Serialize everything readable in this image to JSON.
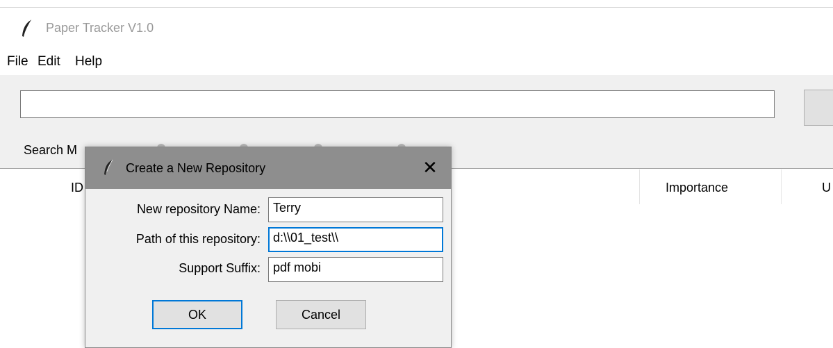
{
  "window": {
    "title": "Paper Tracker V1.0",
    "icon": "feather-icon"
  },
  "menu": {
    "items": [
      "File",
      "Edit",
      "Help"
    ]
  },
  "search": {
    "value": "",
    "mode_label": "Search M"
  },
  "table": {
    "headers": [
      "ID",
      "Importance",
      "U"
    ]
  },
  "dialog": {
    "title": "Create a New Repository",
    "icon": "feather-icon",
    "fields": [
      {
        "label": "New repository Name:",
        "value": "Terry"
      },
      {
        "label": "Path of this repository:",
        "value": "d:\\\\01_test\\\\"
      },
      {
        "label": "Support Suffix:",
        "value": "pdf mobi"
      }
    ],
    "ok_label": "OK",
    "cancel_label": "Cancel",
    "close_glyph": "✕"
  },
  "colors": {
    "dialog_titlebar": "#8e8e8e",
    "focus": "#0078d7",
    "client_bg": "#f0f0f0"
  }
}
